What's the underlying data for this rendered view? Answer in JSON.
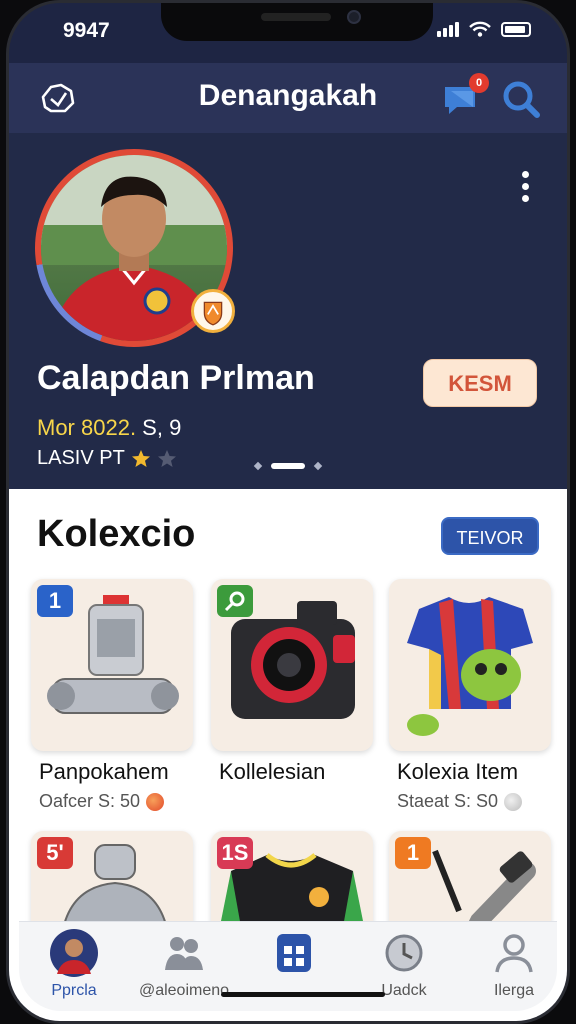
{
  "status": {
    "time": "9947"
  },
  "header": {
    "title": "Denangakah",
    "badge": "0"
  },
  "profile": {
    "name": "Calapdan Prlman",
    "follow_label": "KESM",
    "stat_yellow": "Mor 8022.",
    "stat_rest": " S, 9",
    "rank": "LASIV PT"
  },
  "collection": {
    "title": "Kolexcio",
    "view_label": "TEIVOR",
    "items": [
      {
        "tag": "1",
        "tag_color": "#2a63c9",
        "name": "Panpokahem",
        "price": "Oafcer S: 50"
      },
      {
        "tag": "",
        "tag_color": "#3c9b3c",
        "name": "Kollelesian",
        "price": ""
      },
      {
        "tag": "",
        "tag_color": "",
        "name": "Kolexia Item",
        "price": "Staeat S: S0"
      },
      {
        "tag": "5'",
        "tag_color": "#d83a36",
        "name": "",
        "price": ""
      },
      {
        "tag": "1S",
        "tag_color": "#d83a55",
        "name": "",
        "price": ""
      },
      {
        "tag": "1",
        "tag_color": "#ef7a22",
        "name": "",
        "price": ""
      }
    ]
  },
  "nav": {
    "items": [
      {
        "label": "Pprcla"
      },
      {
        "label": "@aleoimeno"
      },
      {
        "label": ""
      },
      {
        "label": "Uadck"
      },
      {
        "label": "Ilerga"
      }
    ]
  },
  "colors": {
    "accent": "#2d54a9",
    "header_bg": "#2b3358",
    "hero_bg": "#222a48",
    "follow_bg": "#fde7d3"
  }
}
